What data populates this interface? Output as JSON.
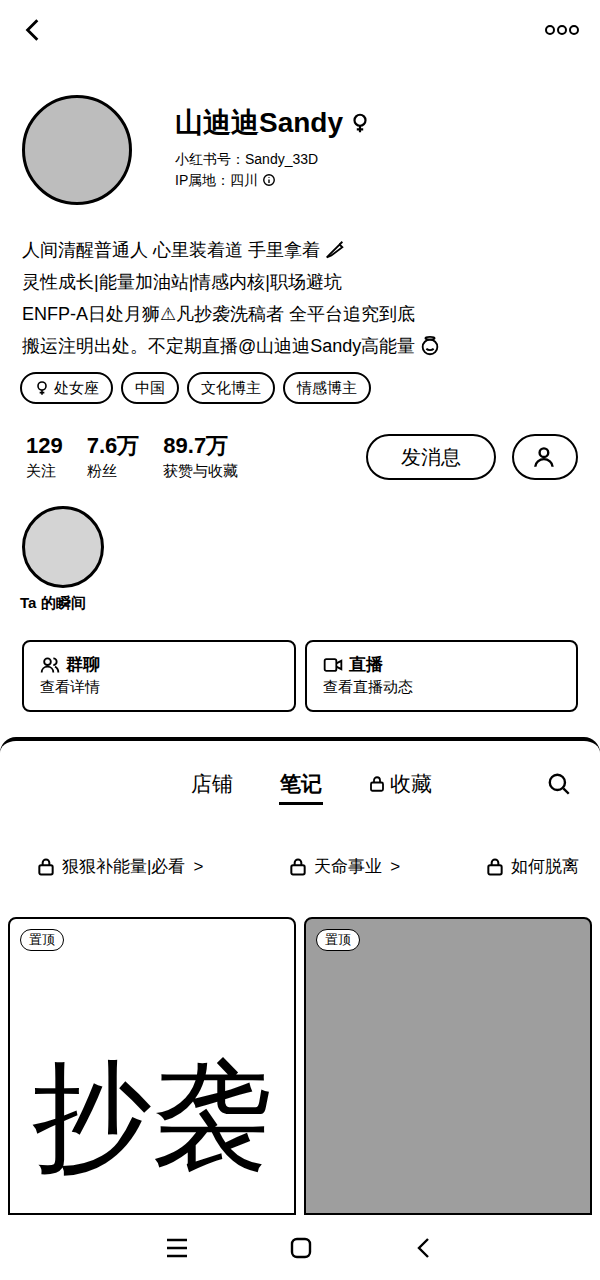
{
  "profile": {
    "name": "山迪迪Sandy",
    "red_id": "小红书号：Sandy_33D",
    "ip": "IP属地：四川"
  },
  "bio": [
    "人间清醒普通人 心里装着道 手里拿着",
    "灵性成长|能量加油站|情感内核|职场避坑",
    "ENFP-A日处月狮⚠凡抄袭洗稿者 全平台追究到底",
    "搬运注明出处。不定期直播@山迪迪Sandy高能量"
  ],
  "tags": [
    {
      "label": "处女座",
      "kind": "gender"
    },
    {
      "label": "中国",
      "kind": "plain"
    },
    {
      "label": "文化博主",
      "kind": "plain"
    },
    {
      "label": "情感博主",
      "kind": "plain"
    }
  ],
  "stats": [
    {
      "value": "129",
      "label": "关注"
    },
    {
      "value": "7.6万",
      "label": "粉丝"
    },
    {
      "value": "89.7万",
      "label": "获赞与收藏"
    }
  ],
  "actions": {
    "message": "发消息"
  },
  "moments": {
    "label": "Ta 的瞬间"
  },
  "features": [
    {
      "title": "群聊",
      "subtitle": "查看详情",
      "kind": "group"
    },
    {
      "title": "直播",
      "subtitle": "查看直播动态",
      "kind": "live"
    }
  ],
  "tabs": [
    {
      "label": "店铺",
      "selected": false,
      "locked": false
    },
    {
      "label": "笔记",
      "selected": true,
      "locked": false
    },
    {
      "label": "收藏",
      "selected": false,
      "locked": true
    }
  ],
  "collections": [
    {
      "label": "狠狠补能量|必看",
      "arrow": ">",
      "locked": true
    },
    {
      "label": "天命事业",
      "arrow": ">",
      "locked": true
    },
    {
      "label": "如何脱离",
      "arrow": "",
      "locked": true
    }
  ],
  "notes": [
    {
      "badge": "置顶",
      "kind": "text",
      "cover_text": "抄袭"
    },
    {
      "badge": "置顶",
      "kind": "photo",
      "cover_text": ""
    }
  ]
}
